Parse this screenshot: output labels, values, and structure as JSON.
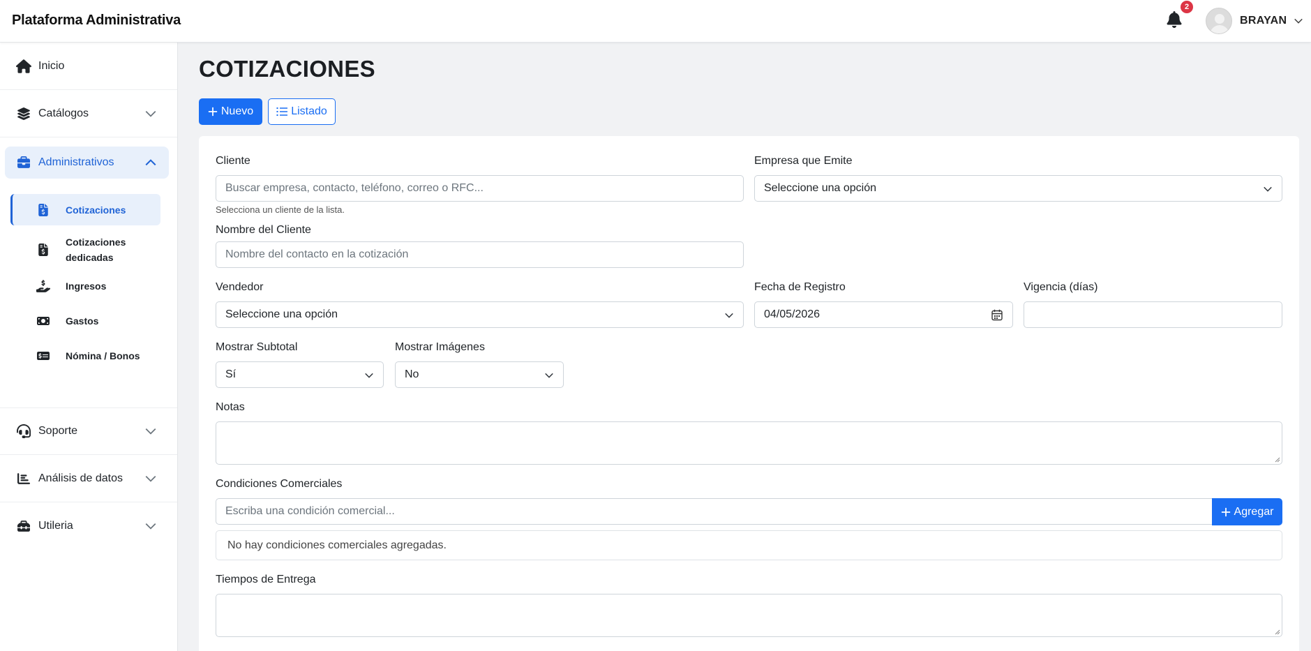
{
  "header": {
    "brand": "Plataforma Administrativa",
    "notifications_count": "2",
    "user_name": "BRAYAN"
  },
  "sidebar": {
    "items": [
      {
        "label": "Inicio",
        "icon": "home-icon"
      },
      {
        "label": "Catálogos",
        "icon": "layers-icon"
      },
      {
        "label": "Administrativos",
        "icon": "briefcase-icon"
      },
      {
        "label": "Soporte",
        "icon": "headset-icon"
      },
      {
        "label": "Análisis de datos",
        "icon": "bar-chart-icon"
      },
      {
        "label": "Utileria",
        "icon": "toolbox-icon"
      }
    ],
    "sub_items": [
      {
        "label": "Cotizaciones",
        "icon": "invoice-dollar-icon"
      },
      {
        "label_line1": "Cotizaciones",
        "label_line2": "dedicadas",
        "icon": "invoice-dollar-icon"
      },
      {
        "label": "Ingresos",
        "icon": "hand-holding-dollar-icon"
      },
      {
        "label": "Gastos",
        "icon": "money-bill-icon"
      },
      {
        "label": "Nómina / Bonos",
        "icon": "money-check-icon"
      }
    ]
  },
  "main": {
    "title": "COTIZACIONES",
    "new_button": "Nuevo",
    "list_button": "Listado",
    "form": {
      "cliente_label": "Cliente",
      "cliente_placeholder": "Buscar empresa, contacto, teléfono, correo o RFC...",
      "cliente_help": "Selecciona un cliente de la lista.",
      "empresa_label": "Empresa que Emite",
      "empresa_value": "Seleccione una opción",
      "nombre_label": "Nombre del Cliente",
      "nombre_placeholder": "Nombre del contacto en la cotización",
      "vendedor_label": "Vendedor",
      "vendedor_value": "Seleccione una opción",
      "fecha_label": "Fecha de Registro",
      "fecha_value": "04/05/2026",
      "vigencia_label": "Vigencia (días)",
      "vigencia_value": "",
      "subtotal_label": "Mostrar Subtotal",
      "subtotal_value": "Sí",
      "imagenes_label": "Mostrar Imágenes",
      "imagenes_value": "No",
      "notas_label": "Notas",
      "condiciones_label": "Condiciones Comerciales",
      "condiciones_placeholder": "Escriba una condición comercial...",
      "agregar_button": "Agregar",
      "condiciones_empty": "No hay condiciones comerciales agregadas.",
      "tiempos_label": "Tiempos de Entrega"
    }
  },
  "colors": {
    "primary": "#1a6ef3",
    "active_bg": "#e8f0fb",
    "active_text": "#1f63d6",
    "badge": "#dc3545"
  }
}
